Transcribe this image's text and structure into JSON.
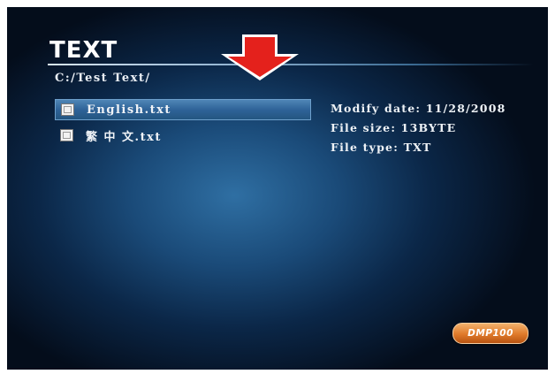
{
  "header": {
    "title": "TEXT"
  },
  "path": "C:/Test  Text/",
  "files": [
    {
      "name": "English.txt",
      "selected": true
    },
    {
      "name": "繁 中 文.txt",
      "selected": false
    }
  ],
  "details": {
    "modify_date": "Modify date: 11/28/2008",
    "file_size": "File size: 13BYTE",
    "file_type": "File type: TXT"
  },
  "badge": {
    "label": "DMP100"
  },
  "colors": {
    "arrow": "#e4211c",
    "selection": "#2f6398",
    "badge": "#e07a2a"
  },
  "icons": [
    "file-icon",
    "down-arrow-icon"
  ]
}
